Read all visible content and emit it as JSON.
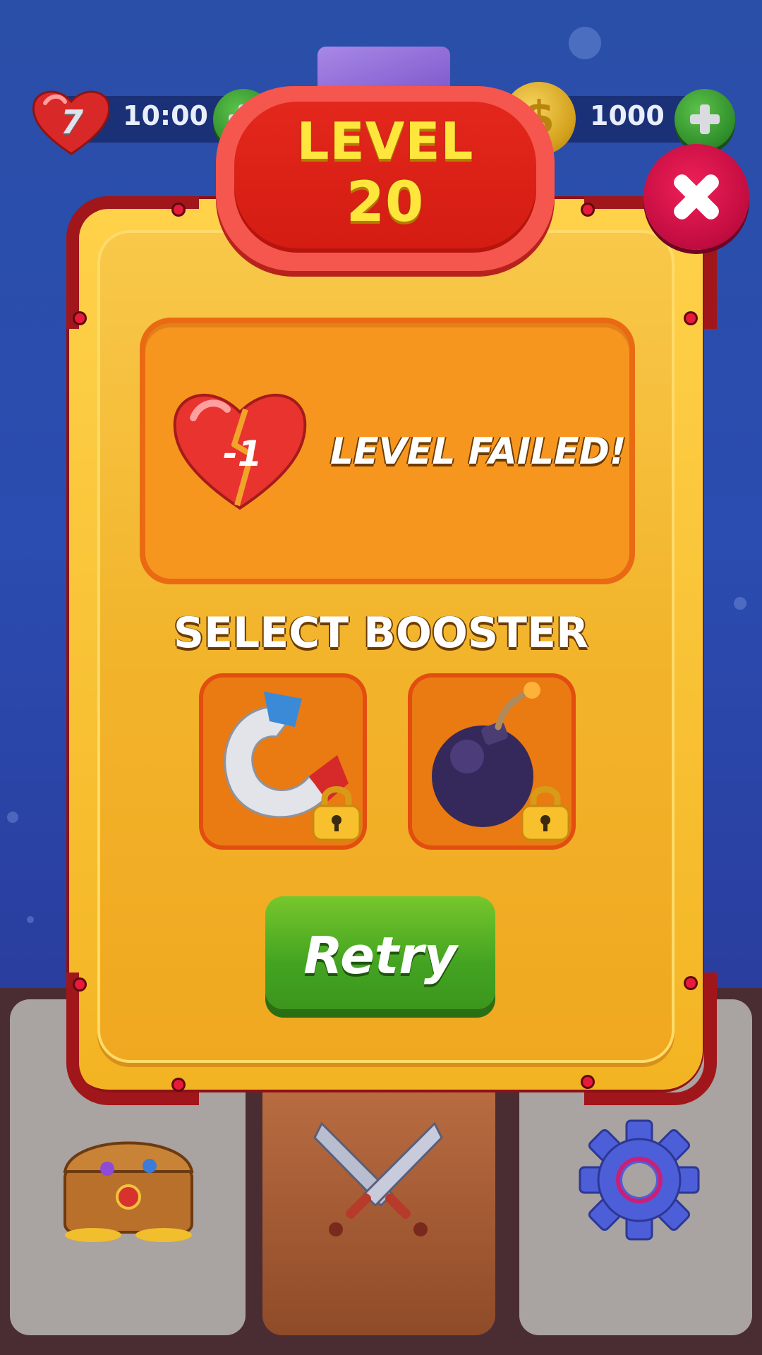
{
  "hud": {
    "lives": "7",
    "timer": "10:00",
    "coins": "1000",
    "coin_symbol": "$"
  },
  "level": {
    "label": "LEVEL",
    "number": "20"
  },
  "result": {
    "heart_delta": "-1",
    "message": "LEVEL FAILED!"
  },
  "boosters": {
    "title": "SELECT BOOSTER",
    "items": [
      {
        "name": "magnet",
        "locked": true
      },
      {
        "name": "bomb",
        "locked": true
      }
    ]
  },
  "actions": {
    "retry_label": "Retry"
  },
  "nav": {
    "items": [
      {
        "icon": "treasure-chest-icon"
      },
      {
        "icon": "crossed-swords-icon",
        "active": true
      },
      {
        "icon": "gear-icon"
      }
    ]
  },
  "colors": {
    "background": "#2a4fa8",
    "level_badge": "#e3271c",
    "level_text": "#ffe63c",
    "panel": "#f2b42b",
    "retry_button": "#43a321",
    "close_button": "#c10c3f"
  }
}
